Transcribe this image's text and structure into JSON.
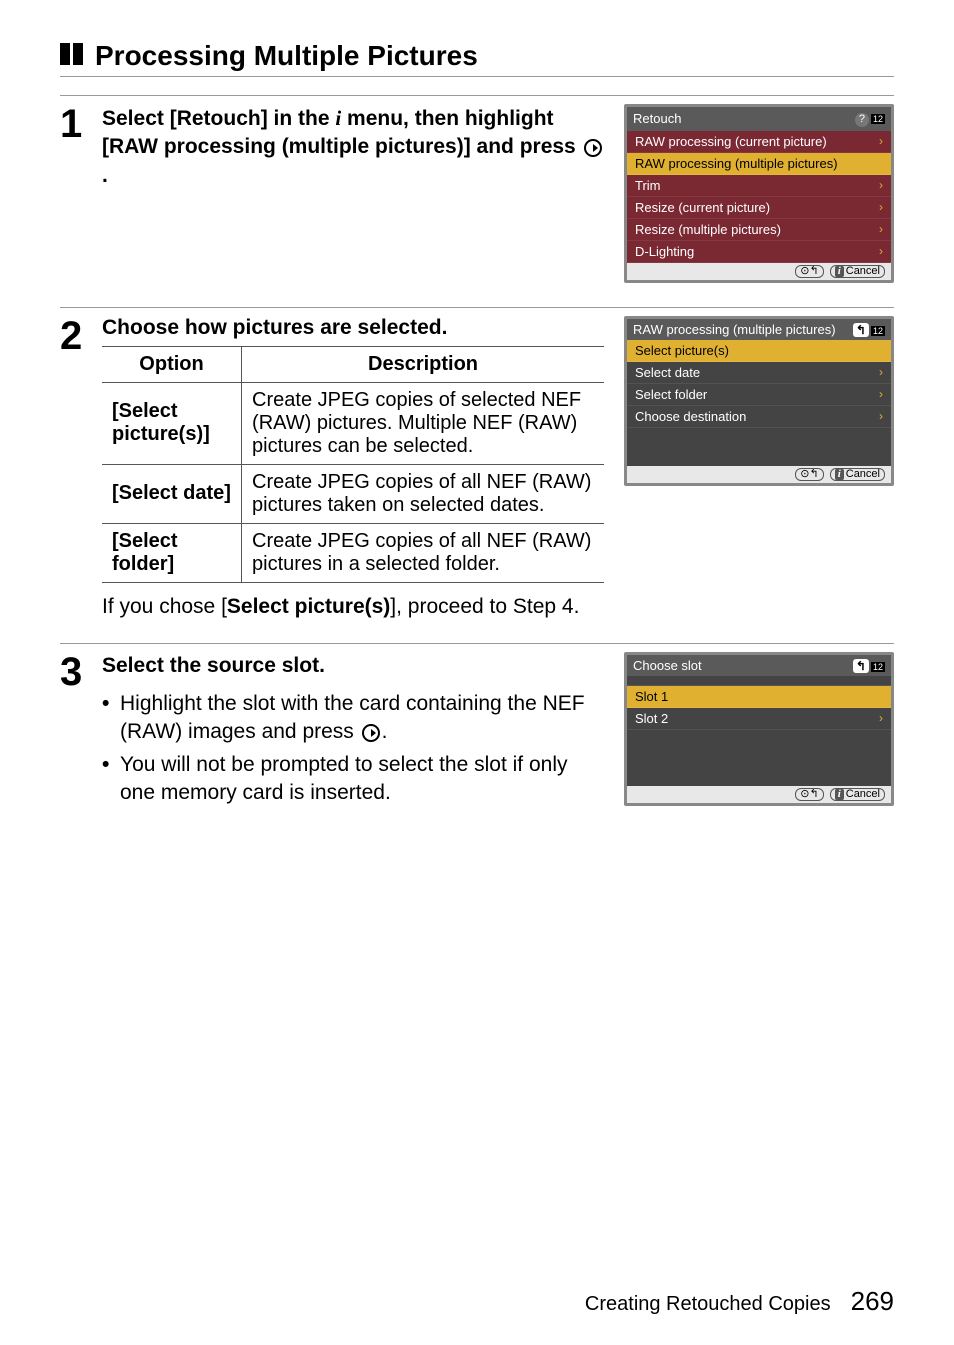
{
  "header": {
    "title": "Processing Multiple Pictures"
  },
  "steps": {
    "s1": {
      "num": "1",
      "text_pre": "Select [Retouch] in the ",
      "text_mid": " menu, then highlight [RAW processing (multiple pictures)] and press ",
      "text_post": "."
    },
    "s2": {
      "num": "2",
      "instruction": "Choose how pictures are selected.",
      "table": {
        "h1": "Option",
        "h2": "Description",
        "r1": {
          "opt": "[Select picture(s)]",
          "desc": "Create JPEG copies of selected NEF (RAW) pictures. Multiple NEF (RAW) pictures can be selected."
        },
        "r2": {
          "opt": "[Select date]",
          "desc": "Create JPEG copies of all NEF (RAW) pictures taken on selected dates."
        },
        "r3": {
          "opt": "[Select folder]",
          "desc": "Create JPEG copies of all NEF (RAW) pictures in a selected folder."
        }
      },
      "after_pre": "If you chose [",
      "after_bold": "Select picture(s)",
      "after_post": "], proceed to Step 4."
    },
    "s3": {
      "num": "3",
      "instruction": "Select the source slot.",
      "b1_pre": "Highlight the slot with the card containing the NEF (RAW) images and press ",
      "b1_post": ".",
      "b2": "You will not be prompted to select the slot if only one memory card is inserted."
    }
  },
  "screens": {
    "s1": {
      "title": "Retouch",
      "rows": {
        "r1": "RAW processing (current picture)",
        "r2": "RAW processing (multiple pictures)",
        "r3": "Trim",
        "r4": "Resize (current picture)",
        "r5": "Resize (multiple pictures)",
        "r6": "D-Lighting"
      },
      "cancel": "Cancel"
    },
    "s2": {
      "title": "RAW processing (multiple pictures)",
      "rows": {
        "r1": "Select picture(s)",
        "r2": "Select date",
        "r3": "Select folder",
        "r4": "Choose destination"
      },
      "cancel": "Cancel"
    },
    "s3": {
      "title": "Choose slot",
      "rows": {
        "r1": "Slot 1",
        "r2": "Slot 2"
      },
      "cancel": "Cancel"
    }
  },
  "footer": {
    "section": "Creating Retouched Copies",
    "page": "269"
  },
  "glyphs": {
    "back": "↰",
    "twelve": "12",
    "dial": "⊙↰"
  }
}
